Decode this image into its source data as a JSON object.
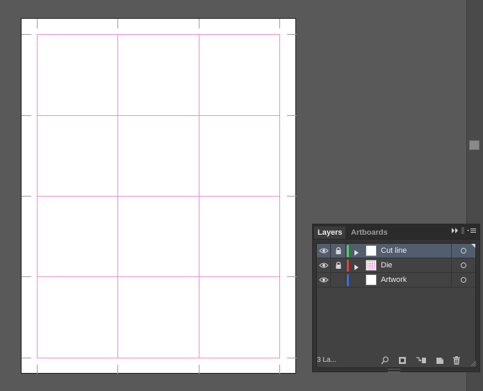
{
  "canvas": {
    "background_color": "#595959",
    "artboard_color": "#ffffff",
    "guide_color": "#e98ad6",
    "crop_mark_color": "#9a9a9a"
  },
  "layers_panel": {
    "tabs": [
      {
        "label": "Layers",
        "active": true
      },
      {
        "label": "Artboards",
        "active": false
      }
    ],
    "menu_icons": [
      "collapse-icon",
      "panel-menu-icon"
    ],
    "layers": [
      {
        "name": "Cut line",
        "color": "#3fdc4b",
        "visible": true,
        "locked": true,
        "expandable": true,
        "selected": true,
        "thumbnail": "blank"
      },
      {
        "name": "Die",
        "color": "#e8403c",
        "visible": true,
        "locked": true,
        "expandable": true,
        "selected": false,
        "thumbnail": "grid"
      },
      {
        "name": "Artwork",
        "color": "#3a6fe0",
        "visible": true,
        "locked": false,
        "expandable": false,
        "selected": false,
        "thumbnail": "blank"
      }
    ],
    "footer": {
      "layer_count": "3 La...",
      "buttons": [
        "locate-object-icon",
        "make-clipping-mask-icon",
        "create-sublayer-icon",
        "create-new-layer-icon",
        "delete-layer-icon"
      ]
    }
  }
}
